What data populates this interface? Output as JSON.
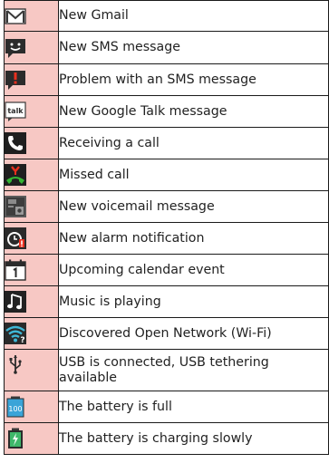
{
  "rows": [
    {
      "icon": "gmail-envelope-icon",
      "label": "New Gmail"
    },
    {
      "icon": "sms-message-icon",
      "label": "New SMS message"
    },
    {
      "icon": "sms-problem-icon",
      "label": "Problem with an SMS message"
    },
    {
      "icon": "google-talk-icon",
      "label": "New Google Talk message"
    },
    {
      "icon": "incoming-call-icon",
      "label": "Receiving a call"
    },
    {
      "icon": "missed-call-icon",
      "label": "Missed call"
    },
    {
      "icon": "voicemail-icon",
      "label": "New voicemail message"
    },
    {
      "icon": "alarm-icon",
      "label": "New alarm notification"
    },
    {
      "icon": "calendar-icon",
      "label": "Upcoming calendar event"
    },
    {
      "icon": "music-note-icon",
      "label": "Music is playing"
    },
    {
      "icon": "open-wifi-icon",
      "label": "Discovered Open Network (Wi-Fi)"
    },
    {
      "icon": "usb-icon",
      "label": "USB is connected, USB tethering available"
    },
    {
      "icon": "battery-full-icon",
      "label": "The battery is full"
    },
    {
      "icon": "battery-charging-icon",
      "label": "The battery is charging slowly"
    }
  ],
  "icon_texts": {
    "talk": "talk",
    "battery": "100"
  },
  "colors": {
    "icon_cell_bg": "#f7c8c4",
    "border": "#1a1a1a"
  }
}
